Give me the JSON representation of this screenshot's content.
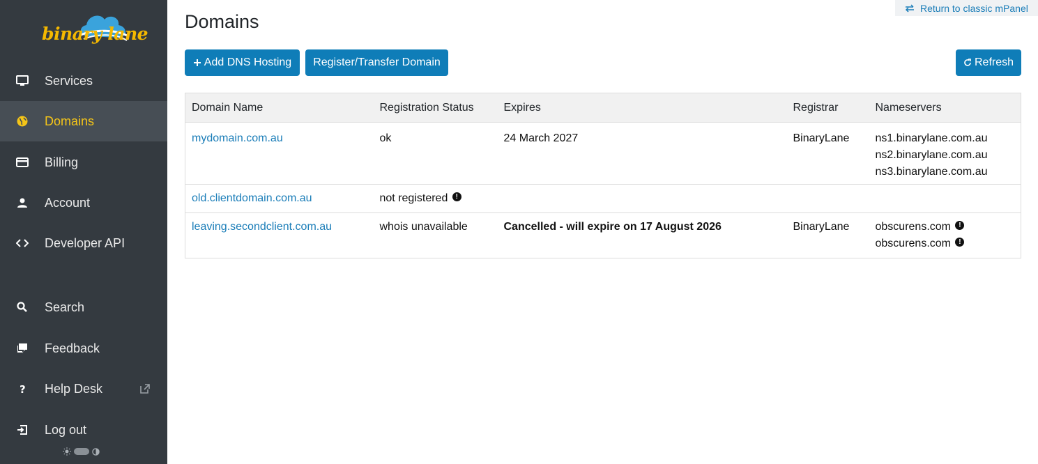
{
  "brand": {
    "logo_text": "binary lane",
    "accent": "#f5b800",
    "cloud": "#3aa3dc"
  },
  "sidebar": {
    "items": [
      {
        "label": "Services",
        "icon": "monitor-icon",
        "active": false
      },
      {
        "label": "Domains",
        "icon": "globe-icon",
        "active": true
      },
      {
        "label": "Billing",
        "icon": "credit-card-icon",
        "active": false
      },
      {
        "label": "Account",
        "icon": "user-icon",
        "active": false
      },
      {
        "label": "Developer API",
        "icon": "code-icon",
        "active": false
      },
      {
        "label": "Search",
        "icon": "search-icon",
        "active": false
      },
      {
        "label": "Feedback",
        "icon": "chat-icon",
        "active": false
      },
      {
        "label": "Help Desk",
        "icon": "question-icon",
        "active": false
      },
      {
        "label": "Log out",
        "icon": "logout-icon",
        "active": false
      }
    ]
  },
  "header": {
    "classic_link": "Return to classic mPanel",
    "title": "Domains"
  },
  "toolbar": {
    "add_dns": "Add DNS Hosting",
    "register_transfer": "Register/Transfer Domain",
    "refresh": "Refresh"
  },
  "table": {
    "columns": [
      "Domain Name",
      "Registration Status",
      "Expires",
      "Registrar",
      "Nameservers"
    ],
    "rows": [
      {
        "domain": "mydomain.com.au",
        "status": "ok",
        "expires": "24 March 2027",
        "registrar": "BinaryLane",
        "nameservers": [
          "ns1.binarylane.com.au",
          "ns2.binarylane.com.au",
          "ns3.binarylane.com.au"
        ]
      },
      {
        "domain": "old.clientdomain.com.au",
        "status": "not registered",
        "expires": "",
        "registrar": "",
        "nameservers": []
      },
      {
        "domain": "leaving.secondclient.com.au",
        "status": "whois unavailable",
        "expires": "Cancelled - will expire on 17 August 2026",
        "registrar": "BinaryLane",
        "nameservers": [
          "obscurens.com",
          "obscurens.com"
        ]
      }
    ]
  },
  "colors": {
    "sidebar_bg": "#343a40",
    "active_bg": "#474e55",
    "primary": "#0f7db8",
    "link": "#1a7db8"
  }
}
